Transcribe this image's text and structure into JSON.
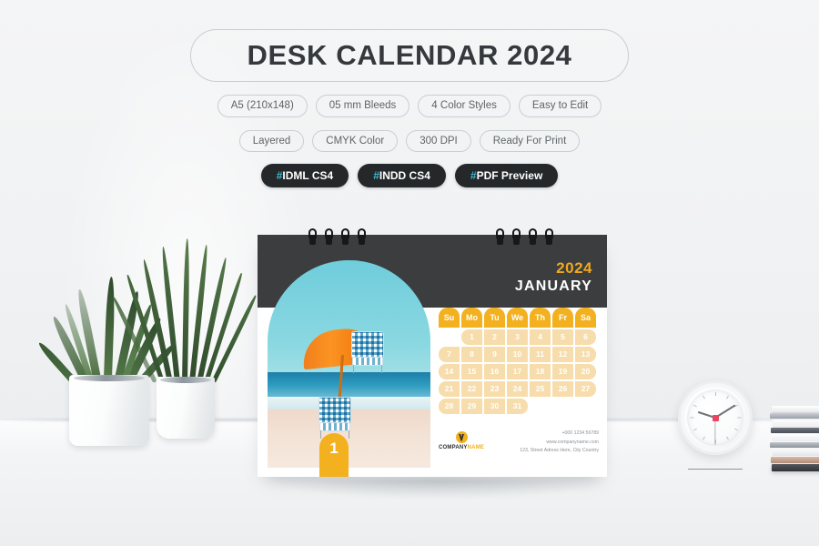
{
  "header": {
    "title": "DESK CALENDAR 2024",
    "tags_row1": [
      "A5 (210x148)",
      "05 mm Bleeds",
      "4 Color Styles",
      "Easy to Edit"
    ],
    "tags_row2": [
      "Layered",
      "CMYK Color",
      "300 DPI",
      "Ready For Print"
    ],
    "hashtags": [
      {
        "symbol": "#",
        "label": "IDML CS4"
      },
      {
        "symbol": "#",
        "label": "INDD CS4"
      },
      {
        "symbol": "#",
        "label": "PDF Preview"
      }
    ]
  },
  "calendar": {
    "year": "2024",
    "month": "JANUARY",
    "month_number": "1",
    "weekday_headers": [
      "Su",
      "Mo",
      "Tu",
      "We",
      "Th",
      "Fr",
      "Sa"
    ],
    "weeks": [
      [
        "",
        "1",
        "2",
        "3",
        "4",
        "5",
        "6"
      ],
      [
        "7",
        "8",
        "9",
        "10",
        "11",
        "12",
        "13"
      ],
      [
        "14",
        "15",
        "16",
        "17",
        "18",
        "19",
        "20"
      ],
      [
        "21",
        "22",
        "23",
        "24",
        "25",
        "26",
        "27"
      ],
      [
        "28",
        "29",
        "30",
        "31",
        "",
        "",
        ""
      ]
    ],
    "footer": {
      "company_primary": "COMPANY",
      "company_secondary": "NAME",
      "phone": "+000 1234 56789",
      "website": "www.companyname.com",
      "address": "123, Street Adress Here, City Country"
    }
  },
  "colors": {
    "accent_orange": "#f3b01f",
    "accent_light": "#f7ddac",
    "header_dark": "#3b3d3f",
    "hash_teal": "#3fb8c8",
    "background": "#f2f3f4"
  },
  "scene": {
    "plant_left": "haworthia-plant",
    "plant_right": "snake-plant",
    "clock": "desk-clock",
    "books": "stacked-books"
  }
}
